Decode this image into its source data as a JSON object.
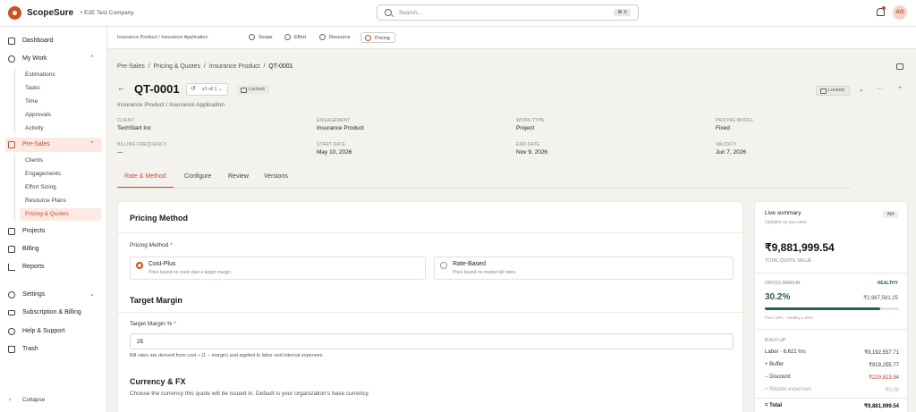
{
  "app": {
    "brand": "ScopeSure",
    "company": "• E2E Test Company",
    "avatar": "AO"
  },
  "search": {
    "placeholder": "Search...",
    "shortcut": "⌘ K"
  },
  "sidebar": {
    "dashboard": "Dashboard",
    "my_work": "My Work",
    "my_work_items": [
      "Estimations",
      "Tasks",
      "Time",
      "Approvals",
      "Activity"
    ],
    "presales": "Pre-Sales",
    "presales_items": [
      "Clients",
      "Engagements",
      "Effort Sizing",
      "Resource Plans",
      "Pricing & Quotes"
    ],
    "projects": "Projects",
    "billing": "Billing",
    "reports": "Reports",
    "settings": "Settings",
    "subscription": "Subscription & Billing",
    "help": "Help & Support",
    "trash": "Trash",
    "collapse": "Collapse"
  },
  "subtoolbar": {
    "breadcrumb": "Insurance Product  /  Insurance Application",
    "tabs": [
      "Scope",
      "Effort",
      "Resource",
      "Pricing"
    ]
  },
  "page": {
    "breadcrumb": [
      "Pre-Sales",
      "Pricing & Quotes",
      "Insurance Product",
      "QT-0001"
    ],
    "title": "QT-0001",
    "version": "v1 of 1",
    "status": "Locked",
    "locked_action": "Locked",
    "subtitle": "Insurance Product  /  Insurance Application"
  },
  "meta": [
    {
      "label": "CLIENT",
      "value": "TechStart Inc"
    },
    {
      "label": "ENGAGEMENT",
      "value": "Insurance Product"
    },
    {
      "label": "WORK TYPE",
      "value": "Project"
    },
    {
      "label": "PRICING MODEL",
      "value": "Fixed"
    },
    {
      "label": "BILLING FREQUENCY",
      "value": "—"
    },
    {
      "label": "START DATE",
      "value": "May 10, 2026"
    },
    {
      "label": "END DATE",
      "value": "Nov 9, 2026"
    },
    {
      "label": "VALIDITY",
      "value": "Jun 7, 2026"
    }
  ],
  "tabs": [
    "Rate & Method",
    "Configure",
    "Review",
    "Versions"
  ],
  "pricing": {
    "method_heading": "Pricing Method",
    "method_label": "Pricing Method",
    "options": [
      {
        "title": "Cost-Plus",
        "desc": "Price based on costs plus a target margin."
      },
      {
        "title": "Rate-Based",
        "desc": "Price based on market bill rates."
      }
    ],
    "margin_heading": "Target Margin",
    "margin_label": "Target Margin %",
    "margin_value": "25",
    "margin_hint": "Bill rates are derived from cost ÷ (1 − margin) and applied to labor and internal expenses.",
    "currency_heading": "Currency & FX",
    "currency_hint": "Choose the currency this quote will be issued in. Default is your organization's base currency."
  },
  "summary": {
    "title": "Live summary",
    "subtitle": "Updates as you save",
    "currency": "INR",
    "total": "₹9,881,999.54",
    "total_label": "TOTAL QUOTE VALUE",
    "gm_label": "GROSS MARGIN",
    "gm_status": "HEALTHY",
    "gm_pct": "30.2%",
    "gm_amount": "₹2,987,581.25",
    "gm_progress": 0.86,
    "gm_note": "Floor 15% · Healthy ≥ 25%",
    "buildup_label": "BUILD-UP",
    "rows": [
      {
        "k": "Labor · 6,621 hrs",
        "v": "₹9,192,557.71"
      },
      {
        "k": "+ Buffer",
        "v": "₹919,255.77"
      },
      {
        "k": "− Discount",
        "v": "₹229,813.94"
      },
      {
        "k": "+ Billable expenses",
        "v": "₹0.00"
      },
      {
        "k": "= Total",
        "v": "₹9,881,999.54"
      }
    ]
  },
  "colors": {
    "accent": "#d24e20",
    "healthy": "#2f5f47"
  }
}
